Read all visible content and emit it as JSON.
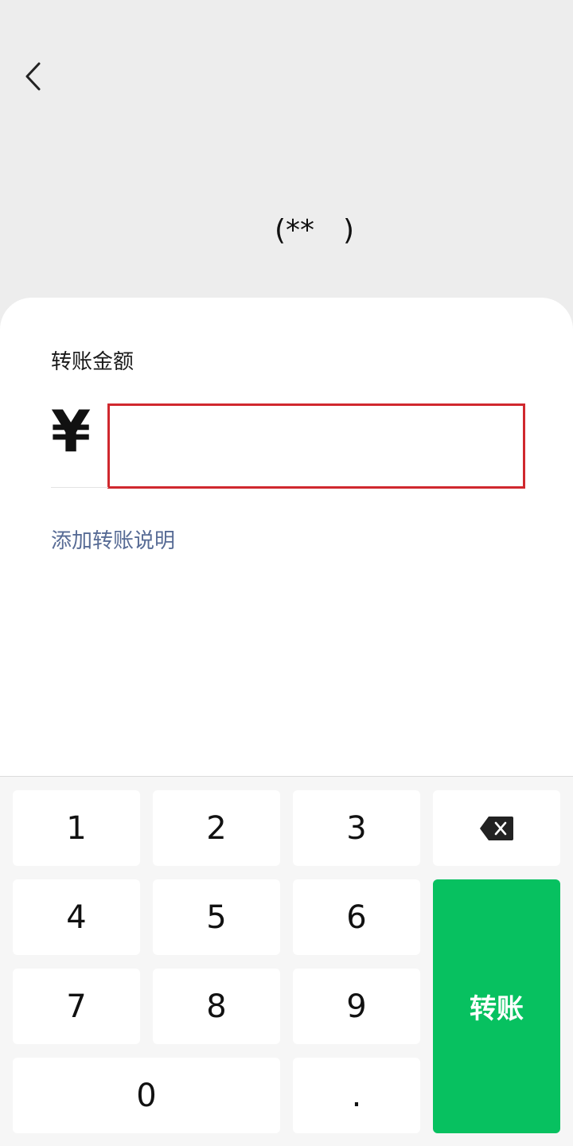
{
  "header": {
    "back_icon": "chevron-left-icon",
    "recipient": "(**  )"
  },
  "transfer": {
    "amount_label": "转账金额",
    "currency_symbol": "¥",
    "amount_value": "",
    "add_note_label": "添加转账说明"
  },
  "keypad": {
    "key_1": "1",
    "key_2": "2",
    "key_3": "3",
    "key_4": "4",
    "key_5": "5",
    "key_6": "6",
    "key_7": "7",
    "key_8": "8",
    "key_9": "9",
    "key_0": "0",
    "key_dot": ".",
    "delete_icon": "backspace-icon",
    "transfer_label": "转账"
  },
  "colors": {
    "page_background": "#ededed",
    "card_background": "#ffffff",
    "link_text": "#576b95",
    "highlight_border": "#d0282e",
    "keypad_background": "#f6f6f6",
    "transfer_button": "#07c160"
  }
}
